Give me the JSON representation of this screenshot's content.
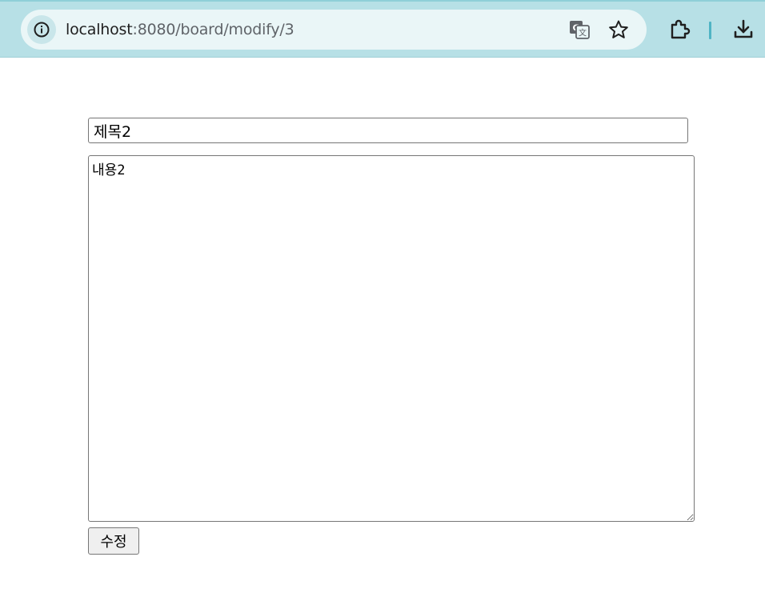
{
  "browser": {
    "url_host": "localhost",
    "url_path": ":8080/board/modify/3",
    "icons": {
      "site_info": "info-icon",
      "translate": "translate-icon",
      "bookmark": "star-icon",
      "extensions": "puzzle-icon",
      "download": "download-icon"
    },
    "colors": {
      "toolbar": "#b7e0e6",
      "omnibox": "#eaf6f7",
      "separator": "#4fb4c4"
    }
  },
  "form": {
    "title_value": "제목2",
    "content_value": "내용2",
    "submit_label": "수정"
  }
}
